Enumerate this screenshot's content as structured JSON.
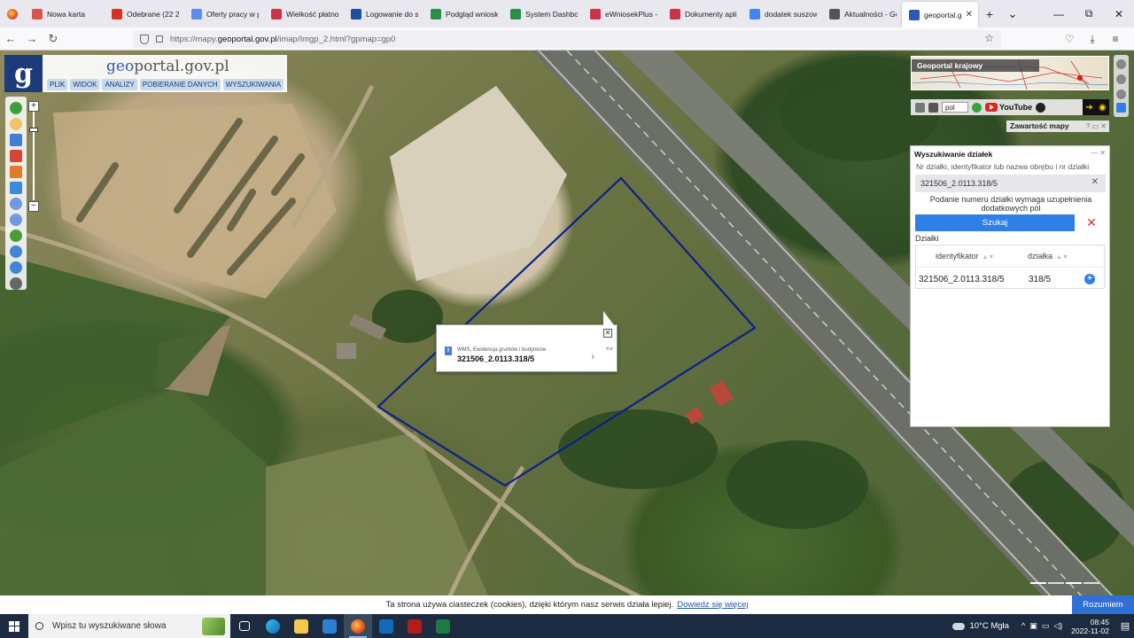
{
  "browser": {
    "tabs": [
      {
        "label": "Nowa karta",
        "color": "#d9534f"
      },
      {
        "label": "Odebrane (22 243",
        "color": "#d93025"
      },
      {
        "label": "Oferty pracy w powi",
        "color": "#5b8def"
      },
      {
        "label": "Wielkość płatnoś",
        "color": "#cc3344"
      },
      {
        "label": "Logowanie do sy",
        "color": "#1d4fa0"
      },
      {
        "label": "Podgląd wniosku",
        "color": "#2a8f4b"
      },
      {
        "label": "System Dashboar",
        "color": "#2a8f4b"
      },
      {
        "label": "eWniosekPlus - Z",
        "color": "#cc3344"
      },
      {
        "label": "Dokumenty aplik",
        "color": "#cc3344"
      },
      {
        "label": "dodatek suszowy",
        "color": "#4285f4"
      },
      {
        "label": "Aktualności - Ge",
        "color": "#555555"
      }
    ],
    "active_tab": {
      "label": "geoportal.gov.",
      "close": "✕"
    },
    "new_tab": "+",
    "tab_list": "⌄",
    "url_prefix": "https://mapy.",
    "url_host": "geoportal.gov.pl",
    "url_path": "/imap/Imgp_2.html?gpmap=gp0",
    "win_controls": [
      "—",
      "⧉",
      "✕"
    ]
  },
  "map": {
    "logo_letter": "g",
    "logo_geo": "geo",
    "logo_rest": "portal.gov.pl",
    "menu": [
      "PLIK",
      "WIDOK",
      "ANALIZY",
      "POBIERANIE DANYCH",
      "WYSZUKIWANIA"
    ],
    "zoom_in": "+",
    "zoom_out": "−",
    "popup": {
      "source": "WMS, Ewidencja gruntów i budynków",
      "value": "321506_2.0113.318/5",
      "info": "i",
      "close": "✕",
      "next": "›",
      "updown": "˄˅"
    },
    "overview_title": "Geoportal krajowy",
    "language": "pol",
    "youtube": "YouTube",
    "contents_label": "Zawartość mapy",
    "contents_ctrl": "? ▭ ✕",
    "colors": {
      "parcel_outline": "#0d1f8c",
      "accent": "#2f7fe8",
      "logo_bg": "#1d3a7a"
    }
  },
  "search": {
    "title": "Wyszukiwanie działek",
    "hdr_ctrl": "— ✕",
    "hint": "Nr działki, identyfikator lub nazwa obrębu i nr działki",
    "input_value": "321506_2.0113.318/5",
    "clear": "✕",
    "message": "Podanie numeru działki wymaga uzupełnienia dodatkowych pól",
    "search_button": "Szukaj",
    "cancel": "✕",
    "section": "Działki",
    "columns": [
      "identyfikator",
      "działka"
    ],
    "rows": [
      {
        "identyfikator": "321506_2.0113.318/5",
        "dzialka": "318/5"
      }
    ],
    "add": "+"
  },
  "cookie": {
    "text": "Ta strona używa ciasteczek (cookies), dzięki którym nasz serwis działa lepiej.",
    "link": "Dowiedz się więcej",
    "button": "Rozumiem"
  },
  "taskbar": {
    "search_placeholder": "Wpisz tu wyszukiwane słowa",
    "weather": "10°C  Mgła",
    "time": "08:45",
    "date": "2022-11-02"
  }
}
